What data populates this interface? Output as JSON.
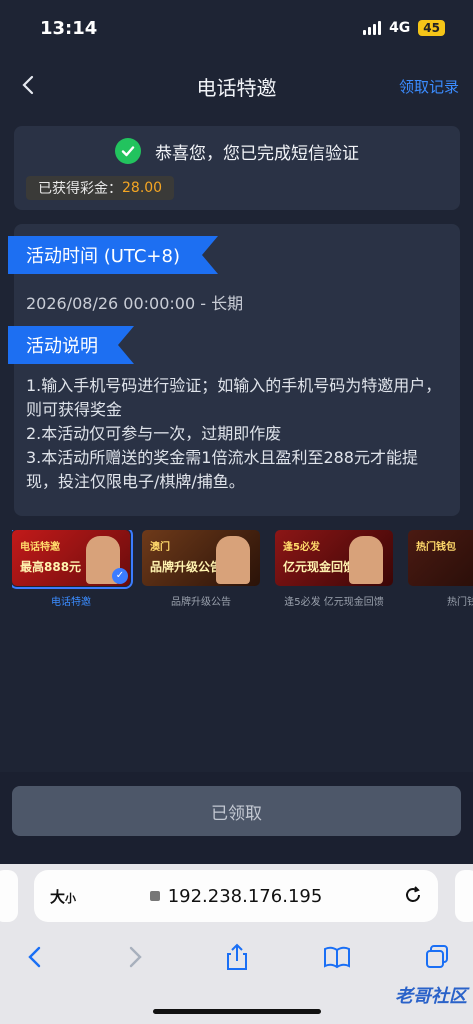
{
  "status": {
    "time": "13:14",
    "network": "4G",
    "battery": "45"
  },
  "nav": {
    "title": "电话特邀",
    "right_link": "领取记录"
  },
  "verify": {
    "message": "恭喜您，您已完成短信验证",
    "reward_label": "已获得彩金：",
    "reward_value": "28.00"
  },
  "activity": {
    "time_header": "活动时间 (UTC+8)",
    "time_value": "2026/08/26 00:00:00 - 长期",
    "desc_header": "活动说明",
    "desc_lines": [
      "1.输入手机号码进行验证；如输入的手机号码为特邀用户，则可获得奖金",
      "2.本活动仅可参与一次，过期即作废",
      "3.本活动所赠送的奖金需1倍流水且盈利至288元才能提现，投注仅限电子/棋牌/捕鱼。"
    ]
  },
  "banners": [
    {
      "label": "电话特邀",
      "title": "电话特邀",
      "sub": "最高888元",
      "bg": "#b01818",
      "active": true
    },
    {
      "label": "品牌升级公告",
      "title": "澳门",
      "sub": "品牌升级公告",
      "bg": "#5a2a12",
      "active": false
    },
    {
      "label": "逢5必发 亿元现金回馈",
      "title": "逢5必发",
      "sub": "亿元现金回馈",
      "bg": "#7a1010",
      "active": false
    },
    {
      "label": "热门钱包",
      "title": "热门钱包",
      "sub": "",
      "bg": "#3a1410",
      "active": false
    }
  ],
  "claim_button": "已领取",
  "browser": {
    "text_size": "大",
    "text_size_small": "小",
    "url": "192.238.176.195"
  },
  "watermark": "老哥社区"
}
